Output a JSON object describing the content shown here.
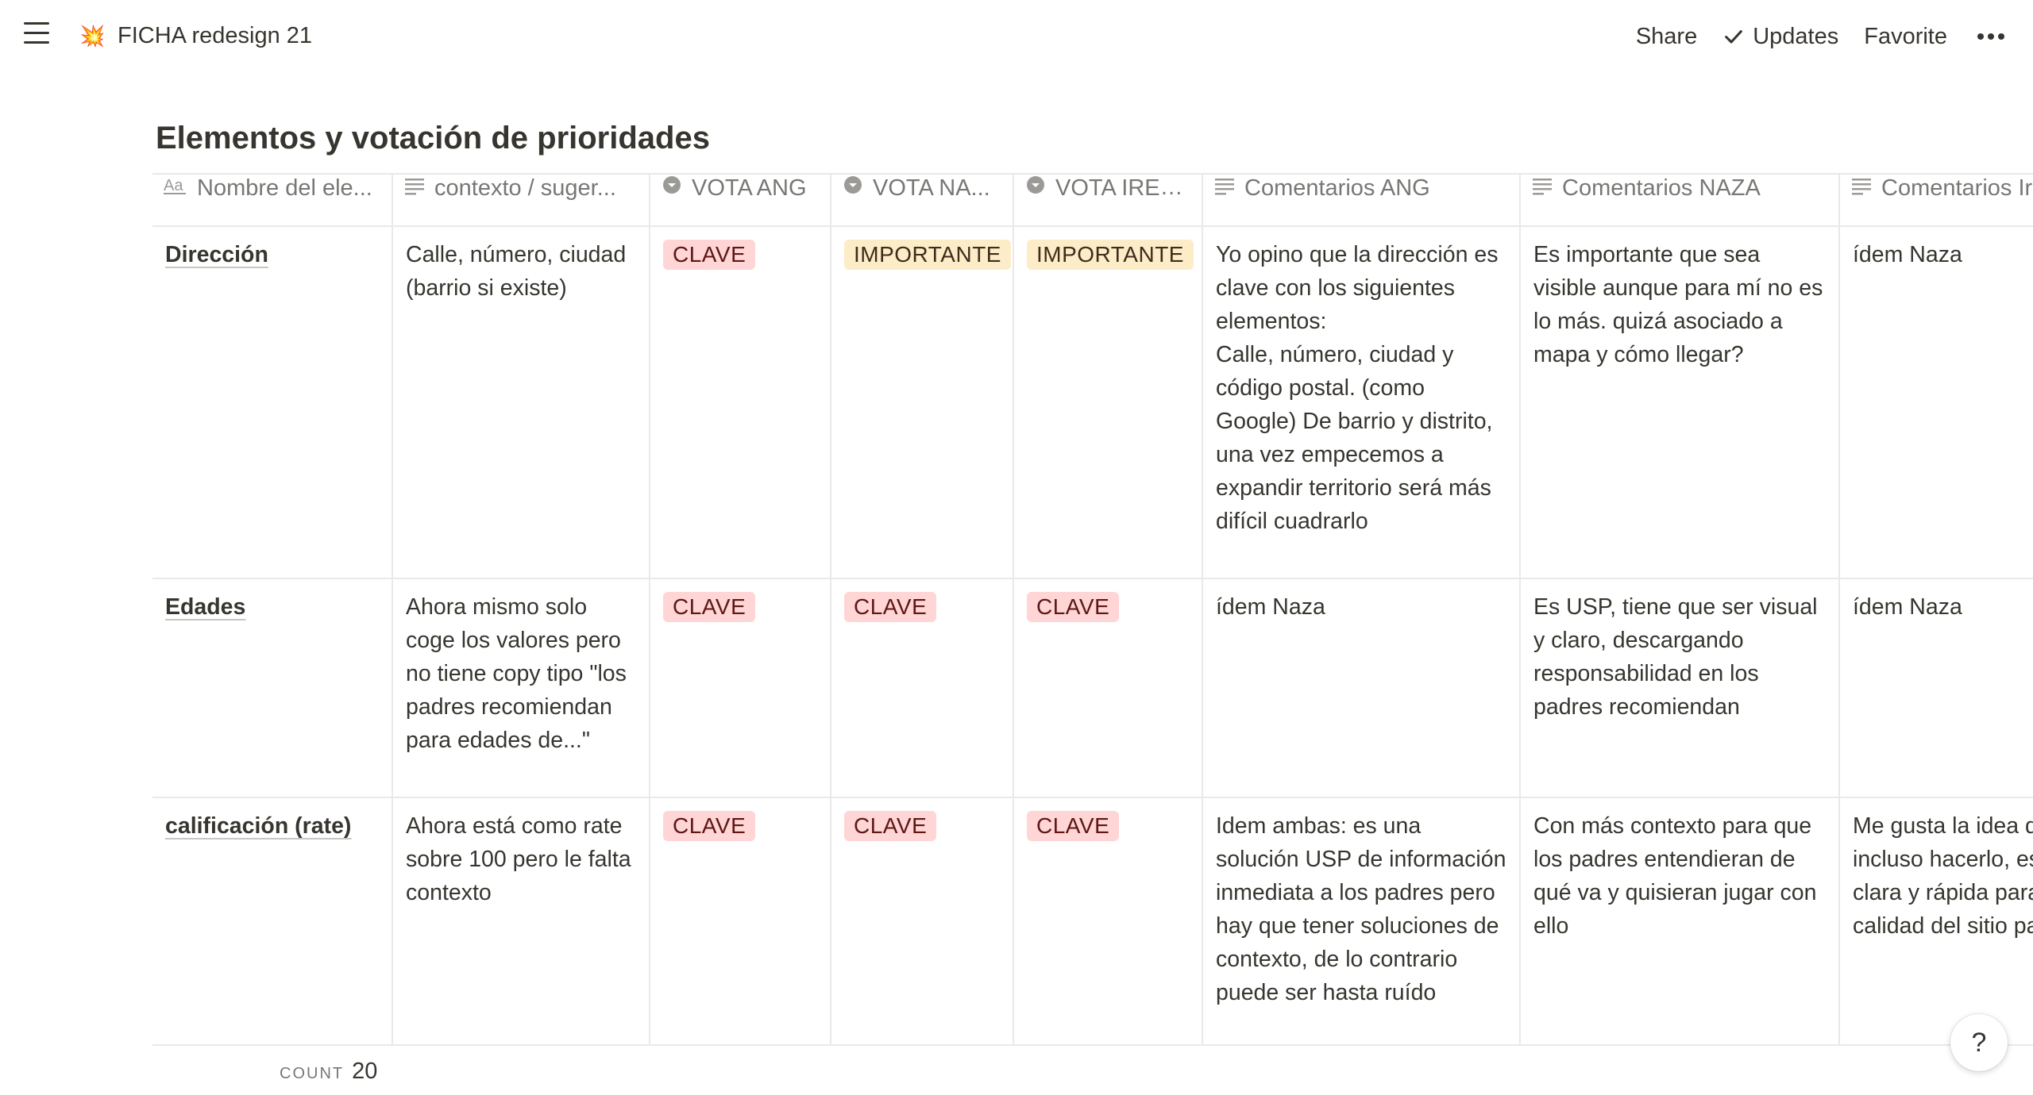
{
  "topbar": {
    "page_icon": "💥",
    "breadcrumb": "FICHA redesign 21",
    "share_label": "Share",
    "updates_label": "Updates",
    "favorite_label": "Favorite"
  },
  "database": {
    "title": "Elementos y votación de prioridades",
    "columns": [
      {
        "label": "Nombre del ele...",
        "icon": "title-property-icon"
      },
      {
        "label": "contexto / suger...",
        "icon": "text-property-icon"
      },
      {
        "label": "VOTA ANG",
        "icon": "select-property-icon"
      },
      {
        "label": "VOTA NA...",
        "icon": "select-property-icon"
      },
      {
        "label": "VOTA IRENE",
        "icon": "select-property-icon"
      },
      {
        "label": "Comentarios ANG",
        "icon": "text-property-icon"
      },
      {
        "label": "Comentarios NAZA",
        "icon": "text-property-icon"
      },
      {
        "label": "Comentarios Ir",
        "icon": "text-property-icon"
      }
    ],
    "rows": [
      {
        "name": "Dirección",
        "contexto": "Calle, número, ciudad (barrio si existe)",
        "vota_ang": "CLAVE",
        "vota_naza": "IMPORTANTE",
        "vota_irene": "IMPORTANTE",
        "comentarios_ang": "Yo opino que la dirección es clave con los siguientes elementos:\nCalle, número, ciudad y código postal. (como Google) De barrio y distrito, una vez empecemos a expandir territorio será más difícil cuadrarlo",
        "comentarios_naza": "Es importante que sea visible aunque para mí no es lo más. quizá asociado a mapa y cómo llegar?",
        "comentarios_irene": "ídem Naza"
      },
      {
        "name": "Edades",
        "contexto": "Ahora mismo solo coge los valores pero no tiene copy tipo \"los padres recomiendan para edades de...\"",
        "vota_ang": "CLAVE",
        "vota_naza": "CLAVE",
        "vota_irene": "CLAVE",
        "comentarios_ang": "ídem Naza",
        "comentarios_naza": "Es USP, tiene que ser visual y claro, descargando responsabilidad en los padres recomiendan",
        "comentarios_irene": "ídem Naza"
      },
      {
        "name": "calificación (rate)",
        "contexto": "Ahora está como rate sobre 100 pero le falta contexto",
        "vota_ang": "CLAVE",
        "vota_naza": "CLAVE",
        "vota_irene": "CLAVE",
        "comentarios_ang": "Idem ambas: es una solución USP de información inmediata a los padres pero hay que tener soluciones de contexto, de lo contrario puede ser hasta ruído",
        "comentarios_naza": "Con más contexto para que los padres entendieran de qué va y quisieran jugar con ello",
        "comentarios_irene": "Me gusta la idea de contexto, pero incluso hacerlo, es una referencia clara y rápida para orientarte sobre la calidad del sitio para ir con"
      }
    ],
    "count_label": "COUNT",
    "count_value": "20"
  },
  "help_label": "?",
  "colors": {
    "tag_clave_bg": "#ffd5d5",
    "tag_importante_bg": "#fdecc8",
    "text": "#37352f",
    "muted": "#787774",
    "border": "#e9e9e7"
  }
}
